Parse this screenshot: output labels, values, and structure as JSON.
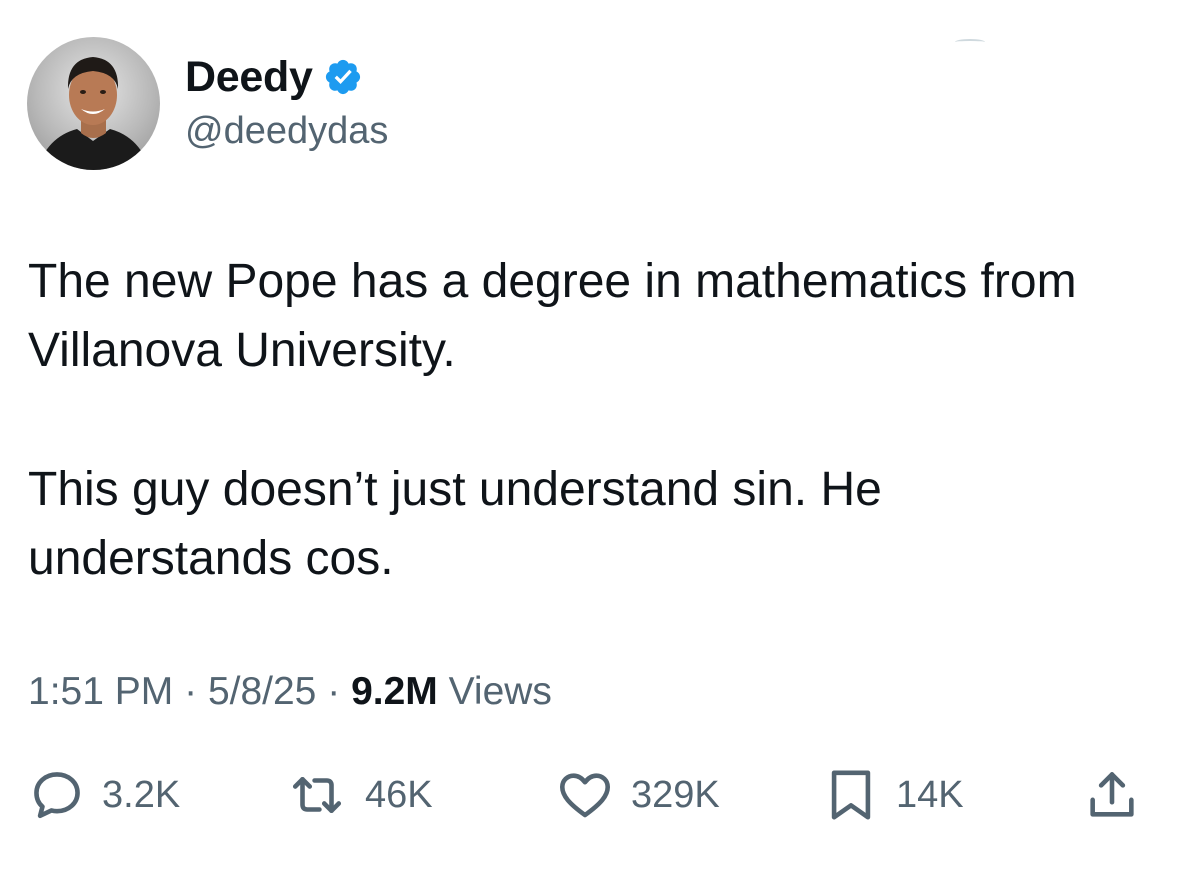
{
  "author": {
    "display_name": "Deedy",
    "handle": "@deedydas",
    "verified": true,
    "verified_color": "#1d9bf0"
  },
  "tweet": {
    "paragraphs": [
      "The new Pope has a degree in mathematics from Villanova University.",
      "This guy doesn’t just understand sin. He understands cos."
    ],
    "time": "1:51 PM",
    "date": "5/8/25",
    "separator": "·",
    "views_count": "9.2M",
    "views_label": "Views"
  },
  "actions": {
    "replies": {
      "icon": "reply-icon",
      "count": "3.2K"
    },
    "reposts": {
      "icon": "repost-icon",
      "count": "46K"
    },
    "likes": {
      "icon": "heart-icon",
      "count": "329K"
    },
    "bookmarks": {
      "icon": "bookmark-icon",
      "count": "14K"
    },
    "share": {
      "icon": "share-icon"
    }
  },
  "colors": {
    "text_primary": "#0f1419",
    "text_secondary": "#536471",
    "accent": "#1d9bf0"
  }
}
